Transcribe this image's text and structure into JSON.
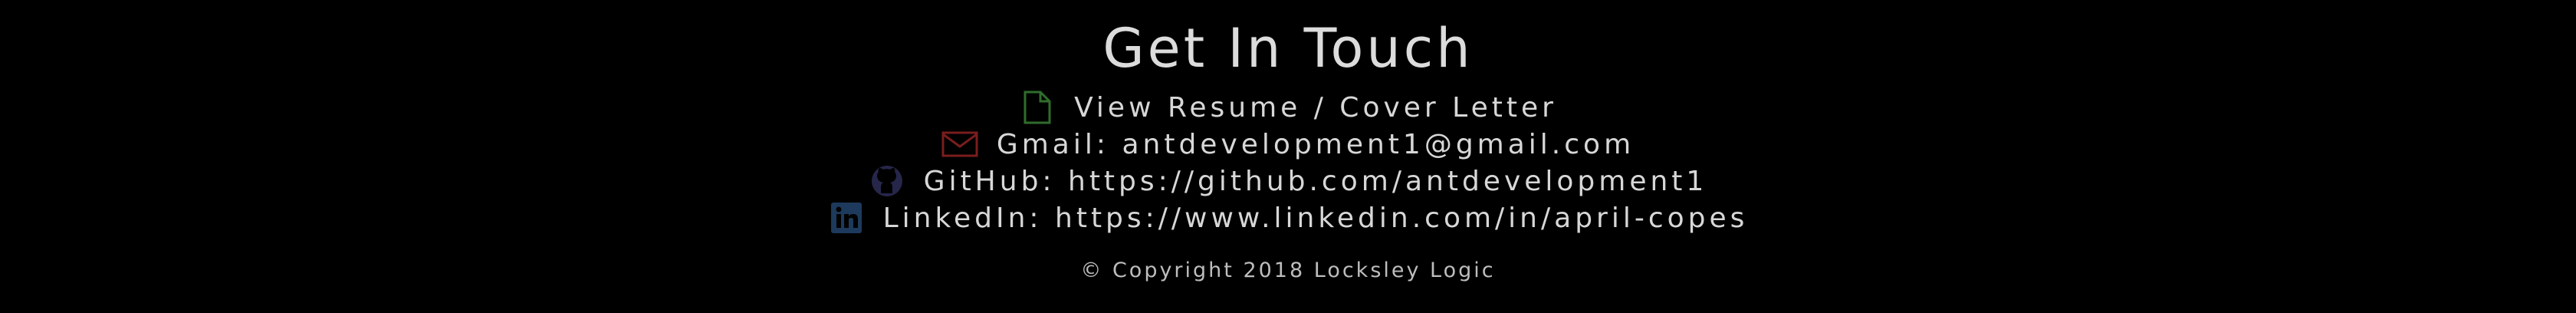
{
  "heading": "Get In Touch",
  "links": [
    {
      "icon": "document-icon",
      "color": "#2f6d2b",
      "text": "View Resume / Cover Letter"
    },
    {
      "icon": "mail-icon",
      "color": "#7a1d1d",
      "text": "Gmail: antdevelopment1@gmail.com"
    },
    {
      "icon": "github-icon",
      "color": "#26264a",
      "text": "GitHub: https://github.com/antdevelopment1"
    },
    {
      "icon": "linkedin-icon",
      "color": "#1d3a5c",
      "text": "LinkedIn: https://www.linkedin.com/in/april-copes"
    }
  ],
  "footer": "© Copyright 2018 Locksley Logic",
  "colors": {
    "background": "#000000",
    "text": "#d7d7d7"
  }
}
